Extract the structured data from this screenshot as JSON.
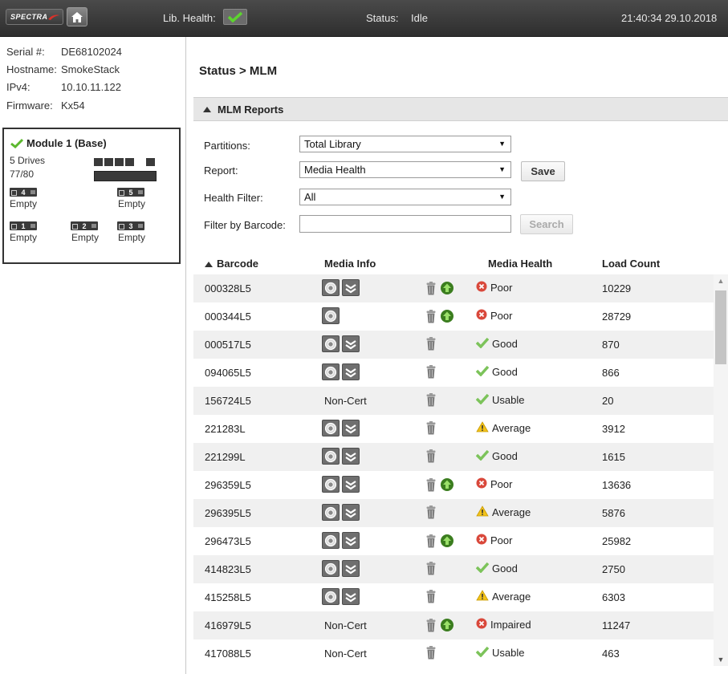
{
  "topbar": {
    "logo_text": "SPECTRA",
    "lib_health_label": "Lib. Health:",
    "status_label": "Status:",
    "status_value": "Idle",
    "datetime": "21:40:34 29.10.2018"
  },
  "system_info": {
    "serial_label": "Serial #:",
    "serial_value": "DE68102024",
    "hostname_label": "Hostname:",
    "hostname_value": "SmokeStack",
    "ipv4_label": "IPv4:",
    "ipv4_value": "10.10.11.122",
    "firmware_label": "Firmware:",
    "firmware_value": "Kx54"
  },
  "module": {
    "title": "Module 1 (Base)",
    "drives": "5 Drives",
    "slots": "77/80",
    "drive_slots": [
      {
        "num": "4",
        "label": "Empty"
      },
      {
        "num": "5",
        "label": "Empty"
      },
      {
        "num": "1",
        "label": "Empty"
      },
      {
        "num": "2",
        "label": "Empty"
      },
      {
        "num": "3",
        "label": "Empty"
      }
    ]
  },
  "main": {
    "breadcrumb": "Status > MLM",
    "section_title": "MLM Reports",
    "form": {
      "partitions_label": "Partitions:",
      "partitions_value": "Total Library",
      "report_label": "Report:",
      "report_value": "Media Health",
      "save_label": "Save",
      "health_filter_label": "Health Filter:",
      "health_filter_value": "All",
      "barcode_label": "Filter by Barcode:",
      "barcode_value": "",
      "search_label": "Search"
    },
    "table": {
      "columns": [
        "Barcode",
        "Media Info",
        "Media Health",
        "Load Count"
      ],
      "rows": [
        {
          "barcode": "000328L5",
          "media_info": "",
          "icons": "both",
          "actions": "trash-up",
          "health": "Poor",
          "health_icon": "poor",
          "load_count": "10229"
        },
        {
          "barcode": "000344L5",
          "media_info": "",
          "icons": "single",
          "actions": "trash-up",
          "health": "Poor",
          "health_icon": "poor",
          "load_count": "28729"
        },
        {
          "barcode": "000517L5",
          "media_info": "",
          "icons": "both",
          "actions": "trash",
          "health": "Good",
          "health_icon": "good",
          "load_count": "870"
        },
        {
          "barcode": "094065L5",
          "media_info": "",
          "icons": "both",
          "actions": "trash",
          "health": "Good",
          "health_icon": "good",
          "load_count": "866"
        },
        {
          "barcode": "156724L5",
          "media_info": "Non-Cert",
          "icons": "none",
          "actions": "trash",
          "health": "Usable",
          "health_icon": "good",
          "load_count": "20"
        },
        {
          "barcode": "221283L",
          "media_info": "",
          "icons": "both",
          "actions": "trash",
          "health": "Average",
          "health_icon": "warn",
          "load_count": "3912"
        },
        {
          "barcode": "221299L",
          "media_info": "",
          "icons": "both",
          "actions": "trash",
          "health": "Good",
          "health_icon": "good",
          "load_count": "1615"
        },
        {
          "barcode": "296359L5",
          "media_info": "",
          "icons": "both",
          "actions": "trash-up",
          "health": "Poor",
          "health_icon": "poor",
          "load_count": "13636"
        },
        {
          "barcode": "296395L5",
          "media_info": "",
          "icons": "both",
          "actions": "trash",
          "health": "Average",
          "health_icon": "warn",
          "load_count": "5876"
        },
        {
          "barcode": "296473L5",
          "media_info": "",
          "icons": "both",
          "actions": "trash-up",
          "health": "Poor",
          "health_icon": "poor",
          "load_count": "25982"
        },
        {
          "barcode": "414823L5",
          "media_info": "",
          "icons": "both",
          "actions": "trash",
          "health": "Good",
          "health_icon": "good",
          "load_count": "2750"
        },
        {
          "barcode": "415258L5",
          "media_info": "",
          "icons": "both",
          "actions": "trash",
          "health": "Average",
          "health_icon": "warn",
          "load_count": "6303"
        },
        {
          "barcode": "416979L5",
          "media_info": "Non-Cert",
          "icons": "none",
          "actions": "trash-up",
          "health": "Impaired",
          "health_icon": "poor",
          "load_count": "11247"
        },
        {
          "barcode": "417088L5",
          "media_info": "Non-Cert",
          "icons": "none",
          "actions": "trash",
          "health": "Usable",
          "health_icon": "good",
          "load_count": "463"
        }
      ]
    }
  },
  "colors": {
    "topbar": "#3a3a3a",
    "ok_green": "#5cb82e",
    "poor_red": "#d9483b",
    "warn_yellow": "#f2c21a",
    "row_stripe": "#f0f0f0"
  }
}
